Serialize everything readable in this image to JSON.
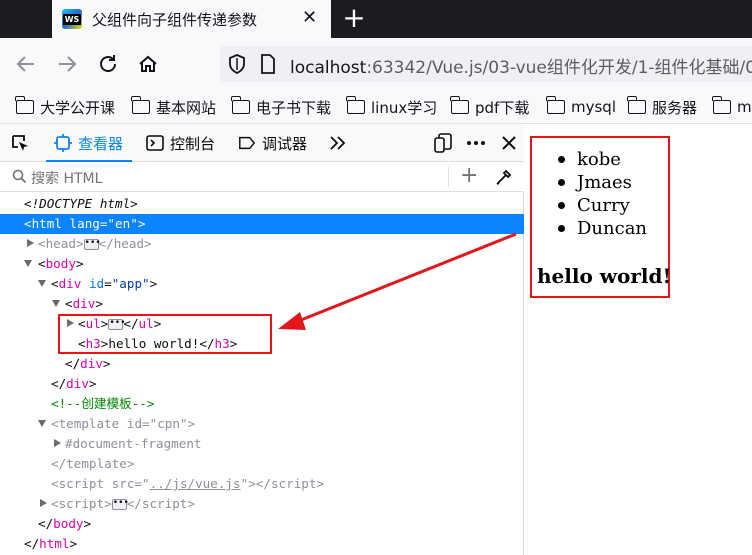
{
  "browser": {
    "tab_title": "父组件向子组件传递参数",
    "favicon_text": "WS",
    "url_host": "localhost",
    "url_path": ":63342/Vue.js/03-vue组件化开发/1-组件化基础/0"
  },
  "bookmarks": [
    "大学公开课",
    "基本网站",
    "电子书下载",
    "linux学习",
    "pdf下载",
    "mysql",
    "服务器",
    "m"
  ],
  "devtools": {
    "tabs": [
      "查看器",
      "控制台",
      "调试器"
    ],
    "search_placeholder": "搜索 HTML",
    "tree": {
      "doctype": "<!DOCTYPE html>",
      "html_open_tag": "html",
      "html_attr": "lang",
      "html_attr_val": "\"en\"",
      "head": "head",
      "body": "body",
      "div": "div",
      "div_id_attr": "id",
      "div_id_val": "\"app\"",
      "ul": "ul",
      "h3": "h3",
      "h3_text": "hello world!",
      "comment": "<!--创建模板-->",
      "template": "template",
      "template_id_val": "\"cpn\"",
      "fragment": "#document-fragment",
      "script": "script",
      "script_src_attr": "src",
      "script_src_val": "../js/vue.js"
    }
  },
  "page": {
    "list_items": [
      "kobe",
      "Jmaes",
      "Curry",
      "Duncan"
    ],
    "heading": "hello world!"
  },
  "colors": {
    "accent": "#0a84ff",
    "annotation_red": "#e3171b",
    "tabstrip": "#1c1b22"
  }
}
